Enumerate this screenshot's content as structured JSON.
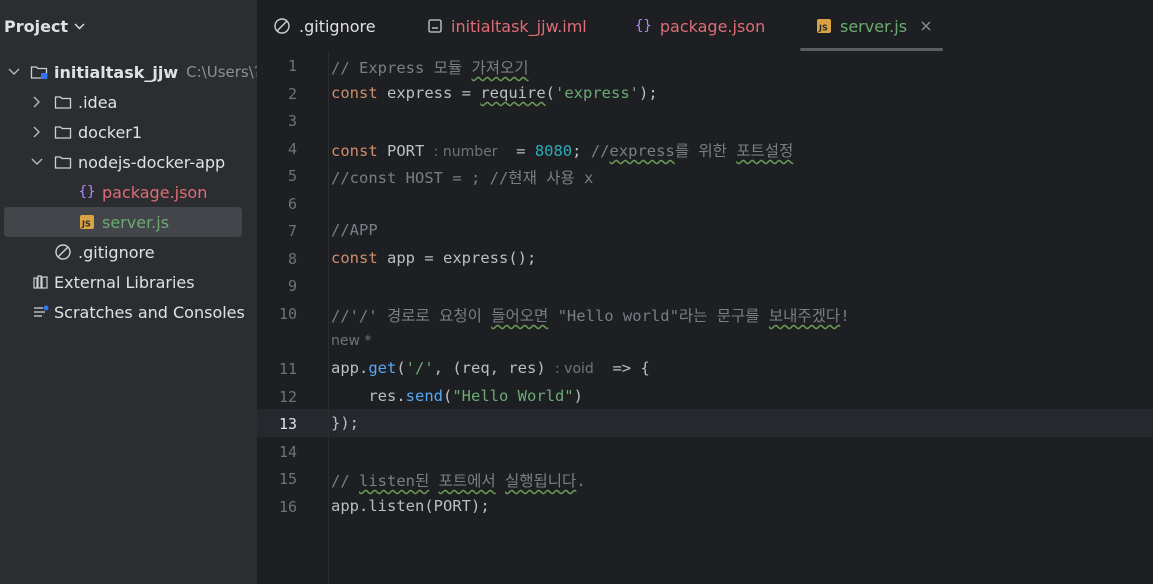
{
  "sidebar": {
    "title": "Project",
    "tree": [
      {
        "label": "initialtask_jjw",
        "path": "C:\\Users\\?",
        "icon": "project-folder-icon"
      },
      {
        "label": ".idea",
        "icon": "folder-icon"
      },
      {
        "label": "docker1",
        "icon": "folder-icon"
      },
      {
        "label": "nodejs-docker-app",
        "icon": "folder-icon"
      },
      {
        "label": "package.json",
        "icon": "json-file-icon"
      },
      {
        "label": "server.js",
        "icon": "js-file-icon"
      },
      {
        "label": ".gitignore",
        "icon": "gitignore-file-icon"
      },
      {
        "label": "External Libraries",
        "icon": "library-icon"
      },
      {
        "label": "Scratches and Consoles",
        "icon": "scratches-icon"
      }
    ]
  },
  "tabs": [
    {
      "label": ".gitignore",
      "icon": "gitignore-file-icon"
    },
    {
      "label": "initialtask_jjw.iml",
      "icon": "iml-file-icon"
    },
    {
      "label": "package.json",
      "icon": "json-file-icon"
    },
    {
      "label": "server.js",
      "icon": "js-file-icon",
      "active": true
    }
  ],
  "editor": {
    "line_numbers": [
      "1",
      "2",
      "3",
      "4",
      "5",
      "6",
      "7",
      "8",
      "9",
      "10",
      "11",
      "12",
      "13",
      "14",
      "15",
      "16"
    ],
    "current_line": "13",
    "inlay_new": "new *",
    "tokens": {
      "l1_comment_a": "// Express 모듈 ",
      "l1_comment_b": "가져오기",
      "l2_const": "const",
      "l2_express": " express = ",
      "l2_require": "require",
      "l2_paren_open": "(",
      "l2_string": "'express'",
      "l2_end": ");",
      "l4_const": "const",
      "l4_port": " PORT ",
      "l4_hint": ": number",
      "l4_eq": "  = ",
      "l4_num": "8080",
      "l4_semi": "; ",
      "l4_comment_a": "//",
      "l4_comment_b": "express",
      "l4_comment_c": "를 위한 ",
      "l4_comment_d": "포트설정",
      "l5_comment": "//const HOST = ; //현재 사용 x",
      "l7_comment": "//APP",
      "l8_const": "const",
      "l8_rest": " app = express();",
      "l10_comment_a": "//'/' 경로로 요청이 ",
      "l10_comment_b": "들어오면",
      "l10_comment_c": " \"Hello world\"라는 문구를 ",
      "l10_comment_d": "보내주겠다",
      "l10_comment_e": "!",
      "l11_app": "app.",
      "l11_get": "get",
      "l11_open": "(",
      "l11_str": "'/'",
      "l11_params": ", (req, res) ",
      "l11_hint": ": void",
      "l11_arrow": "  => {",
      "l12_res": "    res.",
      "l12_send": "send",
      "l12_open": "(",
      "l12_str": "\"Hello World\"",
      "l12_close": ")",
      "l13_close": "});",
      "l15_comment_a": "// ",
      "l15_comment_b": "listen된",
      "l15_comment_c": " ",
      "l15_comment_d": "포트에서",
      "l15_comment_e": " ",
      "l15_comment_f": "실행됩니다",
      "l15_comment_g": ".",
      "l16_app": "app.",
      "l16_listen": "listen",
      "l16_rest": "(PORT);"
    }
  },
  "colors": {
    "sidebar_bg": "#2b2d30",
    "editor_bg": "#1e1f22",
    "keyword": "#cf8e6d",
    "string": "#6aab73",
    "number": "#2aacb8",
    "function": "#56a8f5",
    "comment": "#7a7e85",
    "modified_file": "#e06c75",
    "vcs_added": "#6aab73"
  }
}
